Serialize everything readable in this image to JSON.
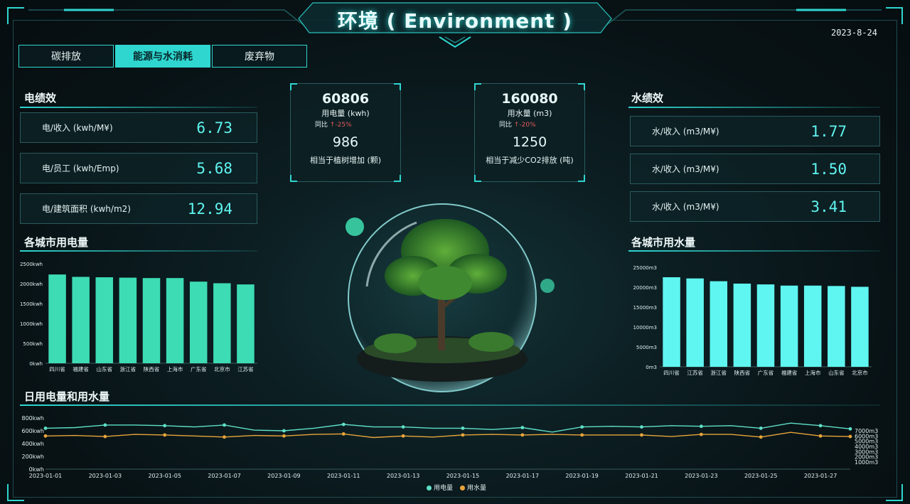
{
  "header": {
    "title": "环境 ( Environment )",
    "date": "2023-8-24"
  },
  "tabs": [
    {
      "label": "碳排放",
      "active": false
    },
    {
      "label": "能源与水消耗",
      "active": true
    },
    {
      "label": "废弃物",
      "active": false
    }
  ],
  "electricity_efficiency": {
    "title": "电绩效",
    "metrics": [
      {
        "label": "电/收入 (kwh/M¥)",
        "value": "6.73"
      },
      {
        "label": "电/员工 (kwh/Emp)",
        "value": "5.68"
      },
      {
        "label": "电/建筑面积 (kwh/m2)",
        "value": "12.94"
      }
    ]
  },
  "water_efficiency": {
    "title": "水绩效",
    "metrics": [
      {
        "label": "水/收入 (m3/M¥)",
        "value": "1.77"
      },
      {
        "label": "水/收入 (m3/M¥)",
        "value": "1.50"
      },
      {
        "label": "水/收入 (m3/M¥)",
        "value": "3.41"
      }
    ]
  },
  "electricity_card": {
    "value": "60806",
    "label": "用电量 (kwh)",
    "yoy_label": "同比",
    "yoy_value": "↑-25%",
    "equiv_value": "986",
    "equiv_label": "相当于植树增加 (颗)"
  },
  "water_card": {
    "value": "160080",
    "label": "用水量 (m3)",
    "yoy_label": "同比",
    "yoy_value": "↑-20%",
    "equiv_value": "1250",
    "equiv_label": "相当于减少CO2排放 (吨)"
  },
  "colors": {
    "accent": "#2fd6d0",
    "elec_bar": "#3ddcb4",
    "water_bar": "#5ff5f0",
    "elec_line": "#5fe0c8",
    "water_line": "#e8a53a"
  },
  "icons": {
    "globe": "terrarium-globe-image"
  },
  "chart_data": [
    {
      "type": "bar",
      "title": "各城市用电量",
      "categories": [
        "四川省",
        "福建省",
        "山东省",
        "浙江省",
        "陕西省",
        "上海市",
        "广东省",
        "北京市",
        "江苏省"
      ],
      "values": [
        2230,
        2170,
        2160,
        2150,
        2140,
        2140,
        2050,
        2010,
        1980
      ],
      "ylim": [
        0,
        2500
      ],
      "yticks": [
        "0kwh",
        "500kwh",
        "1000kwh",
        "1500kwh",
        "2000kwh",
        "2500kwh"
      ],
      "ylabel": "",
      "xlabel": ""
    },
    {
      "type": "bar",
      "title": "各城市用水量",
      "categories": [
        "四川省",
        "江苏省",
        "浙江省",
        "陕西省",
        "广东省",
        "福建省",
        "上海市",
        "山东省",
        "北京市"
      ],
      "values": [
        22500,
        22200,
        21500,
        20900,
        20700,
        20400,
        20400,
        20300,
        20100
      ],
      "ylim": [
        0,
        25000
      ],
      "yticks": [
        "0m3",
        "5000m3",
        "10000m3",
        "15000m3",
        "20000m3",
        "25000m3"
      ],
      "ylabel": "",
      "xlabel": ""
    },
    {
      "type": "line",
      "title": "日用电量和用水量",
      "x": [
        "2023-01-01",
        "2023-01-02",
        "2023-01-03",
        "2023-01-04",
        "2023-01-05",
        "2023-01-06",
        "2023-01-07",
        "2023-01-08",
        "2023-01-09",
        "2023-01-10",
        "2023-01-11",
        "2023-01-12",
        "2023-01-13",
        "2023-01-14",
        "2023-01-15",
        "2023-01-16",
        "2023-01-17",
        "2023-01-18",
        "2023-01-19",
        "2023-01-20",
        "2023-01-21",
        "2023-01-22",
        "2023-01-23",
        "2023-01-24",
        "2023-01-25",
        "2023-01-26",
        "2023-01-27",
        "2023-01-28"
      ],
      "xticks": [
        "2023-01-01",
        "2023-01-03",
        "2023-01-05",
        "2023-01-07",
        "2023-01-09",
        "2023-01-11",
        "2023-01-13",
        "2023-01-15",
        "2023-01-17",
        "2023-01-19",
        "2023-01-21",
        "2023-01-23",
        "2023-01-25",
        "2023-01-27"
      ],
      "series": [
        {
          "name": "用电量",
          "axis": "left",
          "values": [
            640,
            650,
            690,
            690,
            680,
            660,
            690,
            610,
            600,
            640,
            700,
            660,
            660,
            640,
            640,
            620,
            650,
            580,
            660,
            670,
            660,
            680,
            670,
            680,
            640,
            720,
            680,
            630
          ]
        },
        {
          "name": "用水量",
          "axis": "right",
          "values": [
            6000,
            6100,
            5900,
            6300,
            6200,
            6000,
            5800,
            6100,
            6000,
            6300,
            6400,
            5700,
            6000,
            5800,
            6200,
            6300,
            6200,
            6300,
            6200,
            6200,
            6200,
            5900,
            6300,
            6300,
            5800,
            6700,
            6000,
            5900
          ]
        }
      ],
      "ylim_left": [
        0,
        800
      ],
      "yticks_left": [
        "0kwh",
        "200kwh",
        "400kwh",
        "600kwh",
        "800kwh"
      ],
      "ylim_right": [
        1000,
        7000
      ],
      "yticks_right": [
        "1000m3",
        "2000m3",
        "3000m3",
        "4000m3",
        "5000m3",
        "6000m3",
        "7000m3"
      ]
    }
  ]
}
